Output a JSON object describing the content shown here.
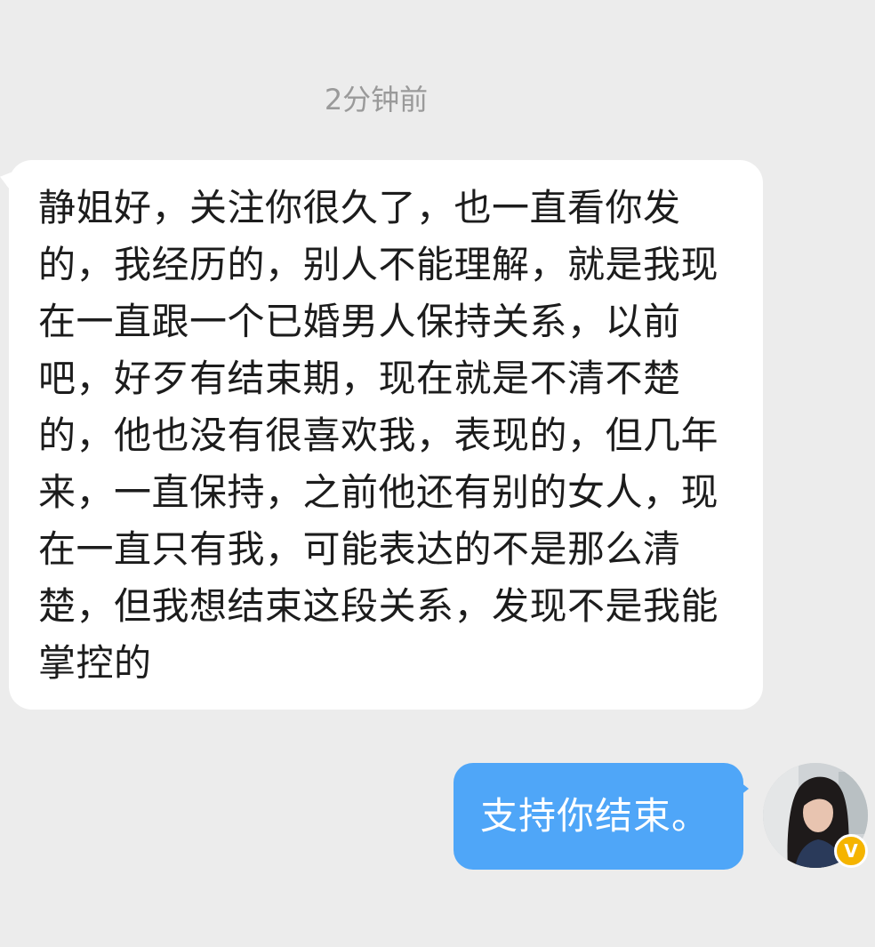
{
  "chat": {
    "timestamp": "2分钟前",
    "incoming_message": "静姐好，关注你很久了，也一直看你发的，我经历的，别人不能理解，就是我现在一直跟一个已婚男人保持关系，以前吧，好歹有结束期，现在就是不清不楚的，他也没有很喜欢我，表现的，但几年来，一直保持，之前他还有别的女人，现在一直只有我，可能表达的不是那么清楚，但我想结束这段关系，发现不是我能掌控的",
    "outgoing_message": "支持你结束。"
  },
  "user": {
    "badge_text": "V",
    "badge_color": "#f5b400"
  },
  "colors": {
    "background": "#ececec",
    "incoming_bubble": "#ffffff",
    "outgoing_bubble": "#4fa6f8"
  }
}
